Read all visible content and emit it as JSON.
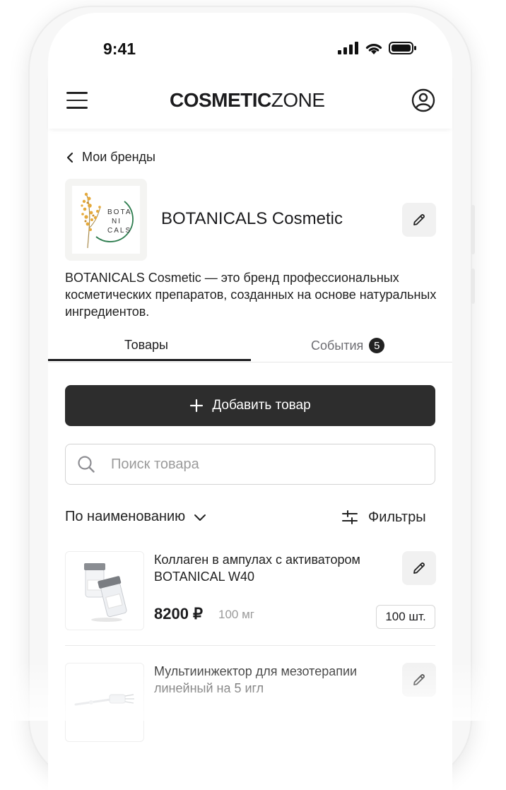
{
  "status_bar": {
    "time": "9:41"
  },
  "header": {
    "logo_bold": "COSMETIC",
    "logo_light": "ZONE"
  },
  "back_link": {
    "label": "Мои бренды"
  },
  "brand": {
    "name": "BOTANICALS Cosmetic",
    "logo_lines": [
      "BOTA",
      "NI",
      "CALS"
    ],
    "logo_accent": "#2e7d4f",
    "description": "BOTANICALS Cosmetic — это бренд профессиональных косметических препаратов, созданных на основе натуральных ингредиентов."
  },
  "tabs": [
    {
      "label": "Товары",
      "active": true
    },
    {
      "label": "События",
      "badge": "5",
      "active": false
    }
  ],
  "actions": {
    "add_product": "Добавить товар"
  },
  "search": {
    "placeholder": "Поиск товара",
    "value": ""
  },
  "sort": {
    "label": "По наименованию"
  },
  "filter": {
    "label": "Фильтры"
  },
  "products": [
    {
      "name": "Коллаген в ампулах с активатором BOTANICAL W40",
      "price": "8200 ₽",
      "unit": "100 мг",
      "quantity": "100 шт."
    },
    {
      "name": "Мультиинжектор для мезотерапии линейный на 5 игл"
    }
  ],
  "colors": {
    "primary_button": "#2d2d2d",
    "text": "#1c1c1e",
    "muted": "#9b9b9b"
  }
}
